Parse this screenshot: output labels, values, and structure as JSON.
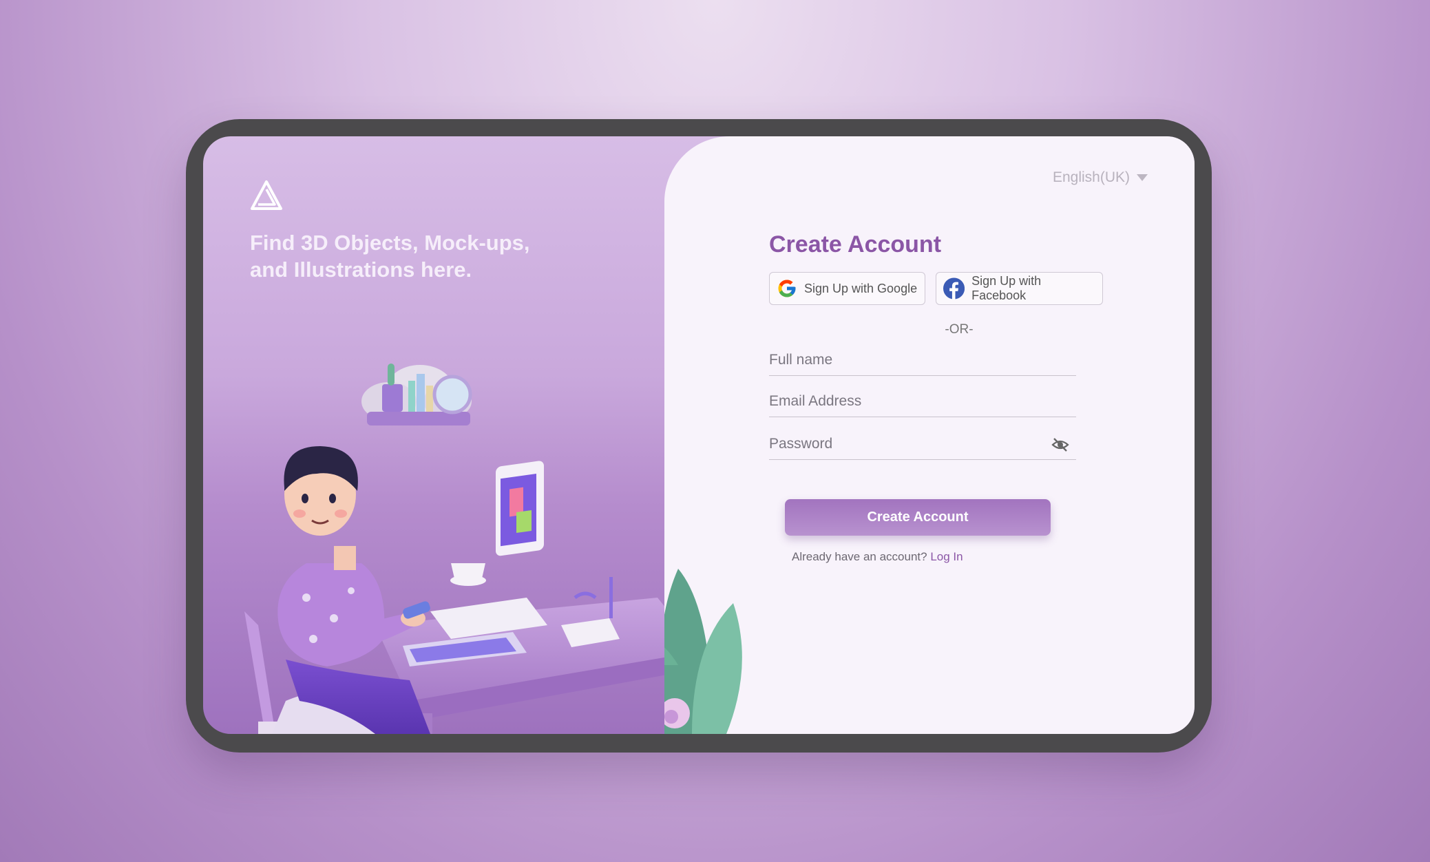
{
  "brand": {
    "tagline_line1": "Find 3D Objects, Mock-ups,",
    "tagline_line2": "and Illustrations here."
  },
  "language": {
    "selected": "English(UK)"
  },
  "form": {
    "title": "Create Account",
    "google_label": "Sign Up with Google",
    "facebook_label": "Sign Up with Facebook",
    "separator": "-OR-",
    "full_name_placeholder": "Full name",
    "email_placeholder": "Email Address",
    "password_placeholder": "Password",
    "submit_label": "Create Account",
    "login_prompt": "Already have an account?",
    "login_link": "Log In"
  },
  "colors": {
    "accent": "#8b56a6",
    "button": "#a274bf",
    "panel": "#f8f3fb",
    "frame": "#4b4a4c"
  },
  "icons": [
    "brand-logo-icon",
    "chevron-down-icon",
    "google-icon",
    "facebook-icon",
    "eye-off-icon"
  ]
}
